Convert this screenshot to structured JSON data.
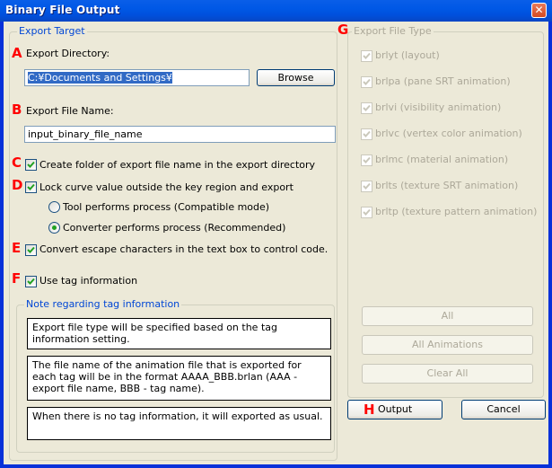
{
  "window": {
    "title": "Binary File Output",
    "close_icon": "close-icon"
  },
  "export_target": {
    "legend": "Export Target",
    "markers": {
      "a": "A",
      "b": "B",
      "c": "C",
      "d": "D",
      "e": "E",
      "f": "F"
    },
    "export_directory_label": "Export Directory:",
    "export_directory_value": "C:¥Documents and Settings¥",
    "browse_label": "Browse",
    "export_file_name_label": "Export File Name:",
    "export_file_name_value": "input_binary_file_name",
    "create_folder": {
      "label": "Create folder of export file name in the export directory",
      "checked": true
    },
    "lock_curve": {
      "label": "Lock curve value outside the key region and export",
      "checked": true
    },
    "radio_tool": {
      "label": "Tool performs process (Compatible mode)",
      "selected": false
    },
    "radio_converter": {
      "label": "Converter performs process (Recommended)",
      "selected": true
    },
    "convert_escape": {
      "label": "Convert escape characters in the text box to control code.",
      "checked": true
    },
    "use_tag": {
      "label": "Use tag information",
      "checked": true
    },
    "note": {
      "legend": "Note regarding tag information",
      "items": [
        "Export file type will be specified based on the tag information setting.",
        "The file name of the animation file that is exported for each tag will be in the format AAAA_BBB.brlan (AAA - export file name, BBB - tag name).",
        "When there is no tag information, it will exported as usual."
      ]
    }
  },
  "export_file_type": {
    "marker": "G",
    "legend": "Export File Type",
    "items": [
      {
        "label": "brlyt (layout)",
        "checked": true,
        "disabled": true
      },
      {
        "label": "brlpa (pane SRT animation)",
        "checked": true,
        "disabled": true
      },
      {
        "label": "brlvi (visibility animation)",
        "checked": true,
        "disabled": true
      },
      {
        "label": "brlvc (vertex color animation)",
        "checked": true,
        "disabled": true
      },
      {
        "label": "brlmc (material animation)",
        "checked": true,
        "disabled": true
      },
      {
        "label": "brlts (texture SRT animation)",
        "checked": true,
        "disabled": true
      },
      {
        "label": "brltp (texture pattern animation)",
        "checked": true,
        "disabled": true
      }
    ],
    "all_label": "All",
    "all_animations_label": "All Animations",
    "clear_all_label": "Clear All"
  },
  "footer": {
    "marker": "H",
    "output_label": "Output",
    "cancel_label": "Cancel"
  }
}
